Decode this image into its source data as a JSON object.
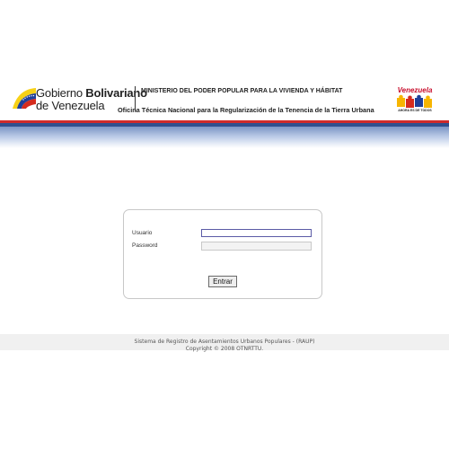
{
  "header": {
    "gob_word1": "Gobierno ",
    "gob_word2": "Bolivariano",
    "gob_line2": "de Venezuela",
    "ministry": "MINISTERIO DEL PODER POPULAR PARA LA VIVIENDA Y HÁBITAT",
    "office": "Oficina Técnica Nacional para la Regularización de la Tenencia de la Tierra Urbana",
    "vzla_word": "Venezuela",
    "vzla_tag": "AHORA ES DE TODOS"
  },
  "login": {
    "user_label": "Usuario",
    "user_value": "",
    "pass_label": "Password",
    "pass_value": "",
    "submit_label": "Entrar"
  },
  "footer": {
    "line1": "Sistema de Registro de Asentamientos Urbanos Populares - (RAUP)",
    "line2": "Copyright © 2008 OTNRTTU."
  },
  "colors": {
    "stripe_red": "#cf2a2a",
    "stripe_blue": "#2f4f8f",
    "input_focus_border": "#5b5ba6"
  },
  "icons": {
    "gov_logo": "venezuela-flag-arc-icon",
    "vzla_logo": "venezuela-ahora-es-de-todos-logo"
  }
}
